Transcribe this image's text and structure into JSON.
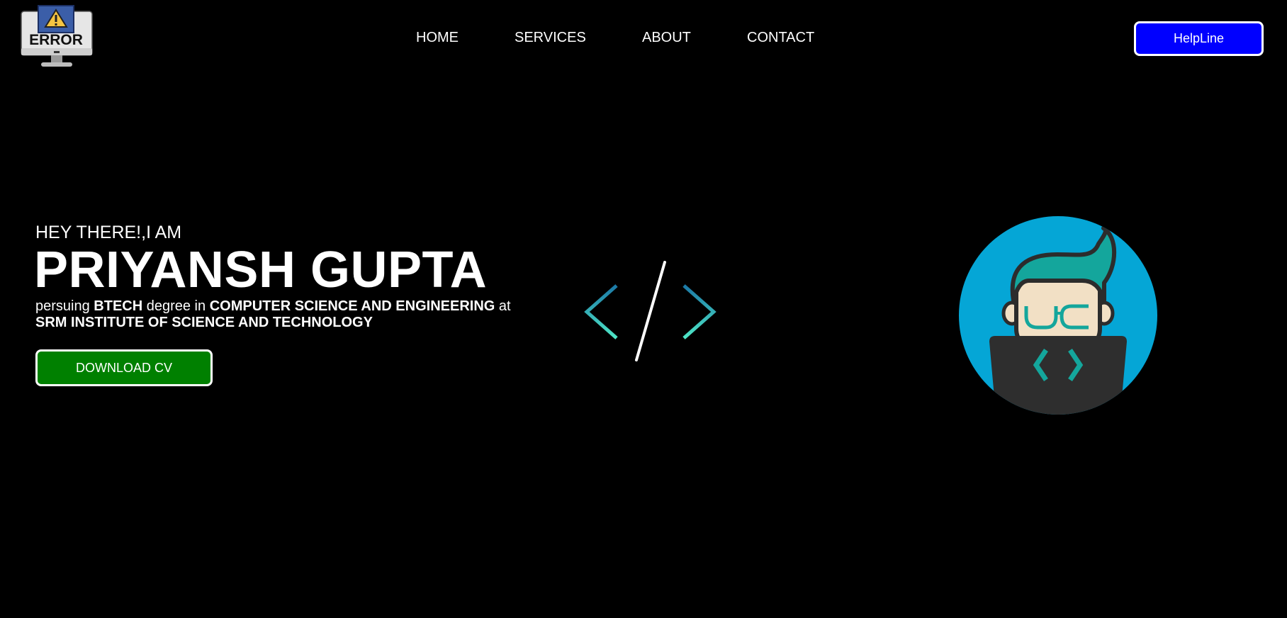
{
  "header": {
    "logo_text": "ERROR",
    "nav": [
      {
        "label": "HOME"
      },
      {
        "label": "SERVICES"
      },
      {
        "label": "ABOUT"
      },
      {
        "label": "CONTACT"
      }
    ],
    "helpline_label": "HelpLine"
  },
  "hero": {
    "greeting": "HEY THERE!,I AM",
    "name": "PRIYANSH GUPTA",
    "desc_1": "persuing ",
    "desc_2": "BTECH",
    "desc_3": " degree in ",
    "desc_4": "COMPUTER SCIENCE AND ENGINEERING",
    "desc_5": " at",
    "desc_6": "SRM INSTITUTE OF SCIENCE AND TECHNOLOGY",
    "download_label": "DOWNLOAD CV"
  },
  "icons": {
    "logo": "error-monitor-icon",
    "code": "code-brackets-icon",
    "avatar": "developer-avatar-icon"
  },
  "colors": {
    "background": "#000000",
    "helpline_bg": "#0000ff",
    "download_bg": "#008000",
    "avatar_circle": "#05a6d6",
    "accent_teal": "#1aa89a"
  }
}
